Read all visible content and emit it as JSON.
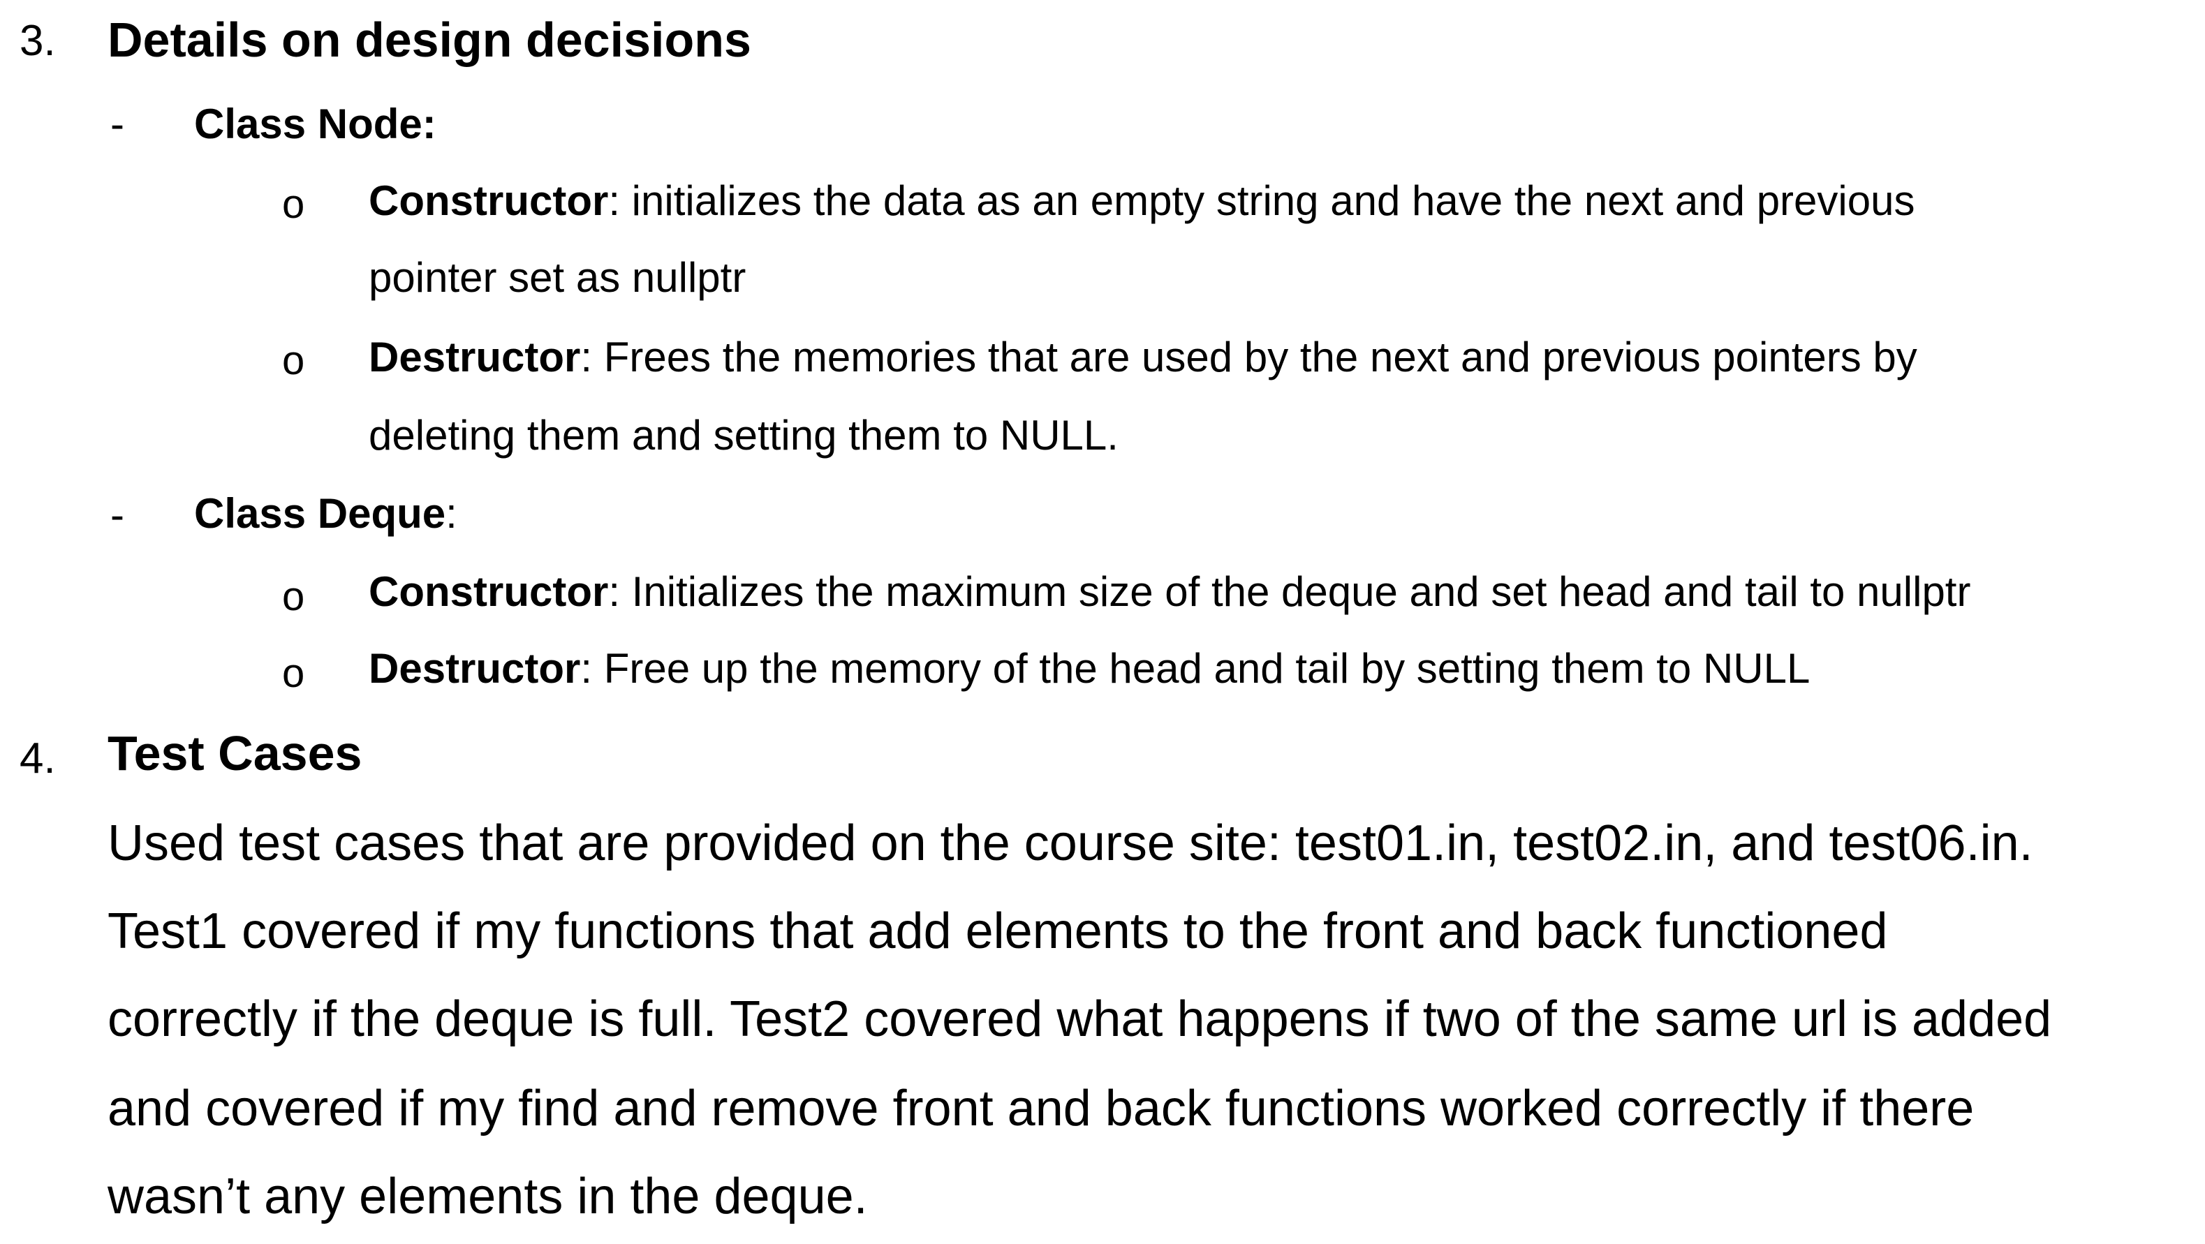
{
  "section3": {
    "number": "3.",
    "title": "Details on design decisions",
    "groups": [
      {
        "marker": "-",
        "label": "Class Node:",
        "label_suffix": "",
        "items": [
          {
            "marker": "o",
            "term": "Constructor",
            "line1": ": initializes the data as an empty string and have the next and previous",
            "line2": "pointer set as nullptr"
          },
          {
            "marker": "o",
            "term": "Destructor",
            "line1": ": Frees the memories that are used by the next and previous pointers by",
            "line2": "deleting them and setting them to NULL."
          }
        ]
      },
      {
        "marker": "-",
        "label": "Class Deque",
        "label_suffix": ":",
        "items": [
          {
            "marker": "o",
            "term": "Constructor",
            "line1": ": Initializes the maximum size of the deque and set head and tail to nullptr"
          },
          {
            "marker": "o",
            "term": "Destructor",
            "line1": ": Free up the memory of the head and tail by setting them to NULL"
          }
        ]
      }
    ]
  },
  "section4": {
    "number": "4.",
    "title": "Test Cases",
    "paragraph_lines": [
      "Used test cases that are provided on the course site: test01.in, test02.in, and test06.in.",
      "Test1 covered if my functions that add elements to the front and back functioned",
      "correctly if the deque is full. Test2 covered what happens if two of the same url is added",
      "and covered if my find and remove front and back functions worked correctly if there",
      "wasn’t any elements in the deque."
    ]
  }
}
